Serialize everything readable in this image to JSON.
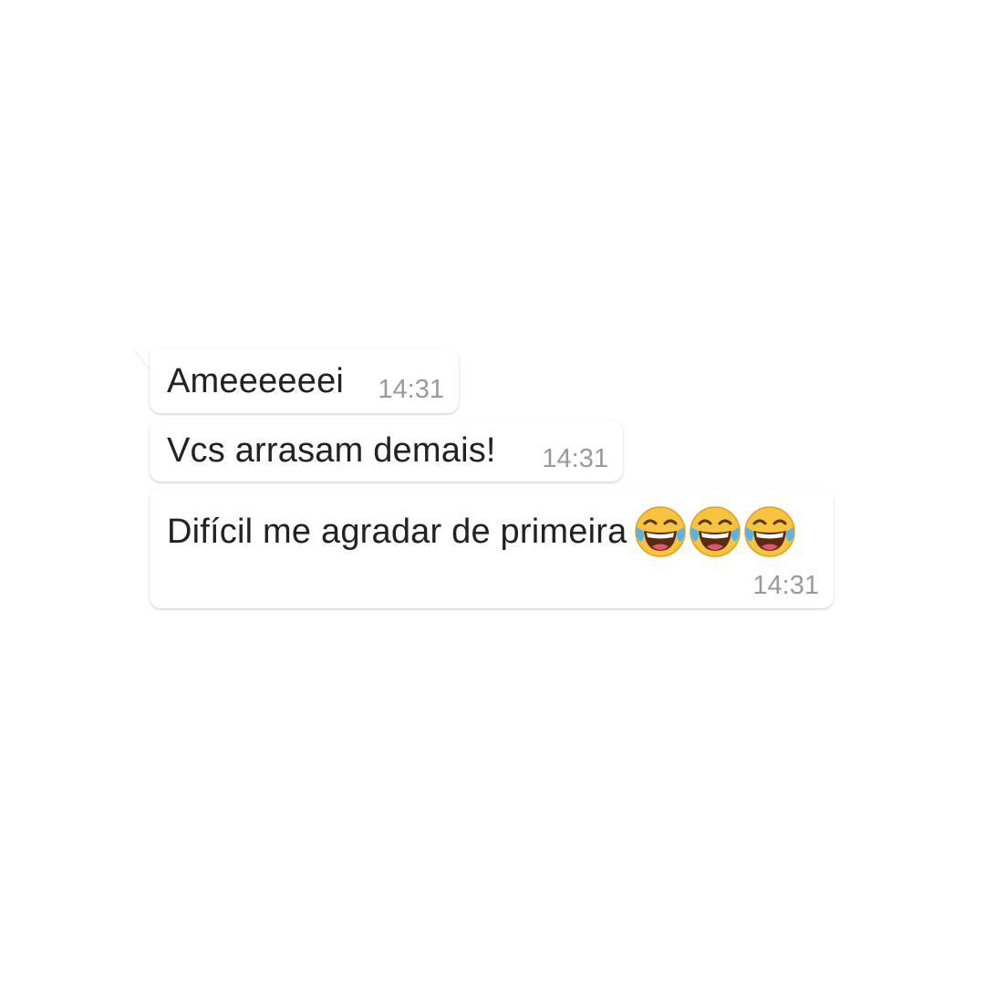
{
  "messages": [
    {
      "text": "Ameeeeeei",
      "time": "14:31"
    },
    {
      "text": "Vcs arrasam demais!",
      "time": "14:31"
    },
    {
      "text": "Difícil me agradar de primeira",
      "time": "14:31",
      "emojis": [
        "face-with-tears-of-joy-icon",
        "face-with-tears-of-joy-icon",
        "face-with-tears-of-joy-icon"
      ]
    }
  ],
  "colors": {
    "background": "#ffffff",
    "bubble": "#ffffff",
    "text": "#222222",
    "timestamp": "#9a9a9a",
    "emoji_face": "#f7c341"
  }
}
